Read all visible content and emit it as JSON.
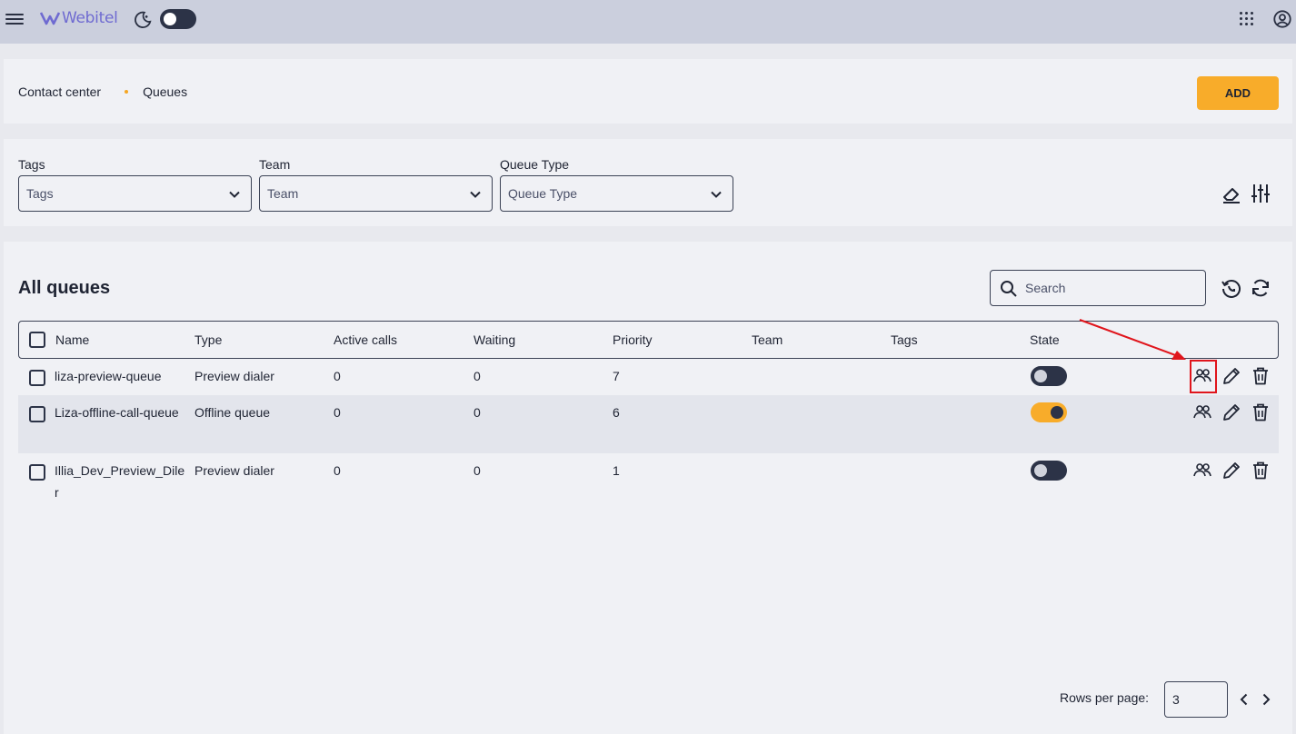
{
  "topbar": {
    "brand": "Webitel",
    "menu_icon": "hamburger-icon",
    "theme_icon": "moon-phone-icon",
    "apps_icon": "apps-grid-icon",
    "account_icon": "user-circle-icon"
  },
  "breadcrumb": {
    "items": [
      "Contact center",
      "Queues"
    ]
  },
  "actions": {
    "add_label": "ADD"
  },
  "filters": [
    {
      "label": "Tags",
      "placeholder": "Tags"
    },
    {
      "label": "Team",
      "placeholder": "Team"
    },
    {
      "label": "Queue Type",
      "placeholder": "Queue Type"
    }
  ],
  "table": {
    "title": "All queues",
    "search_placeholder": "Search",
    "columns": [
      "Name",
      "Type",
      "Active calls",
      "Waiting",
      "Priority",
      "Team",
      "Tags",
      "State"
    ],
    "rows": [
      {
        "name": "liza-preview-queue",
        "type": "Preview dialer",
        "active_calls": "0",
        "waiting": "0",
        "priority": "7",
        "team": "",
        "tags": "",
        "state": false
      },
      {
        "name": "Liza-offline-call-queue",
        "type": "Offline queue",
        "active_calls": "0",
        "waiting": "0",
        "priority": "6",
        "team": "",
        "tags": "",
        "state": true
      },
      {
        "name": "Illia_Dev_Preview_Diler",
        "type": "Preview dialer",
        "active_calls": "0",
        "waiting": "0",
        "priority": "1",
        "team": "",
        "tags": "",
        "state": false
      }
    ]
  },
  "pagination": {
    "rows_per_page_label": "Rows per page:",
    "rows_per_page": "3"
  },
  "colors": {
    "accent": "#f8ac2a",
    "dark": "#2c3347",
    "annotation": "#e0151c"
  }
}
